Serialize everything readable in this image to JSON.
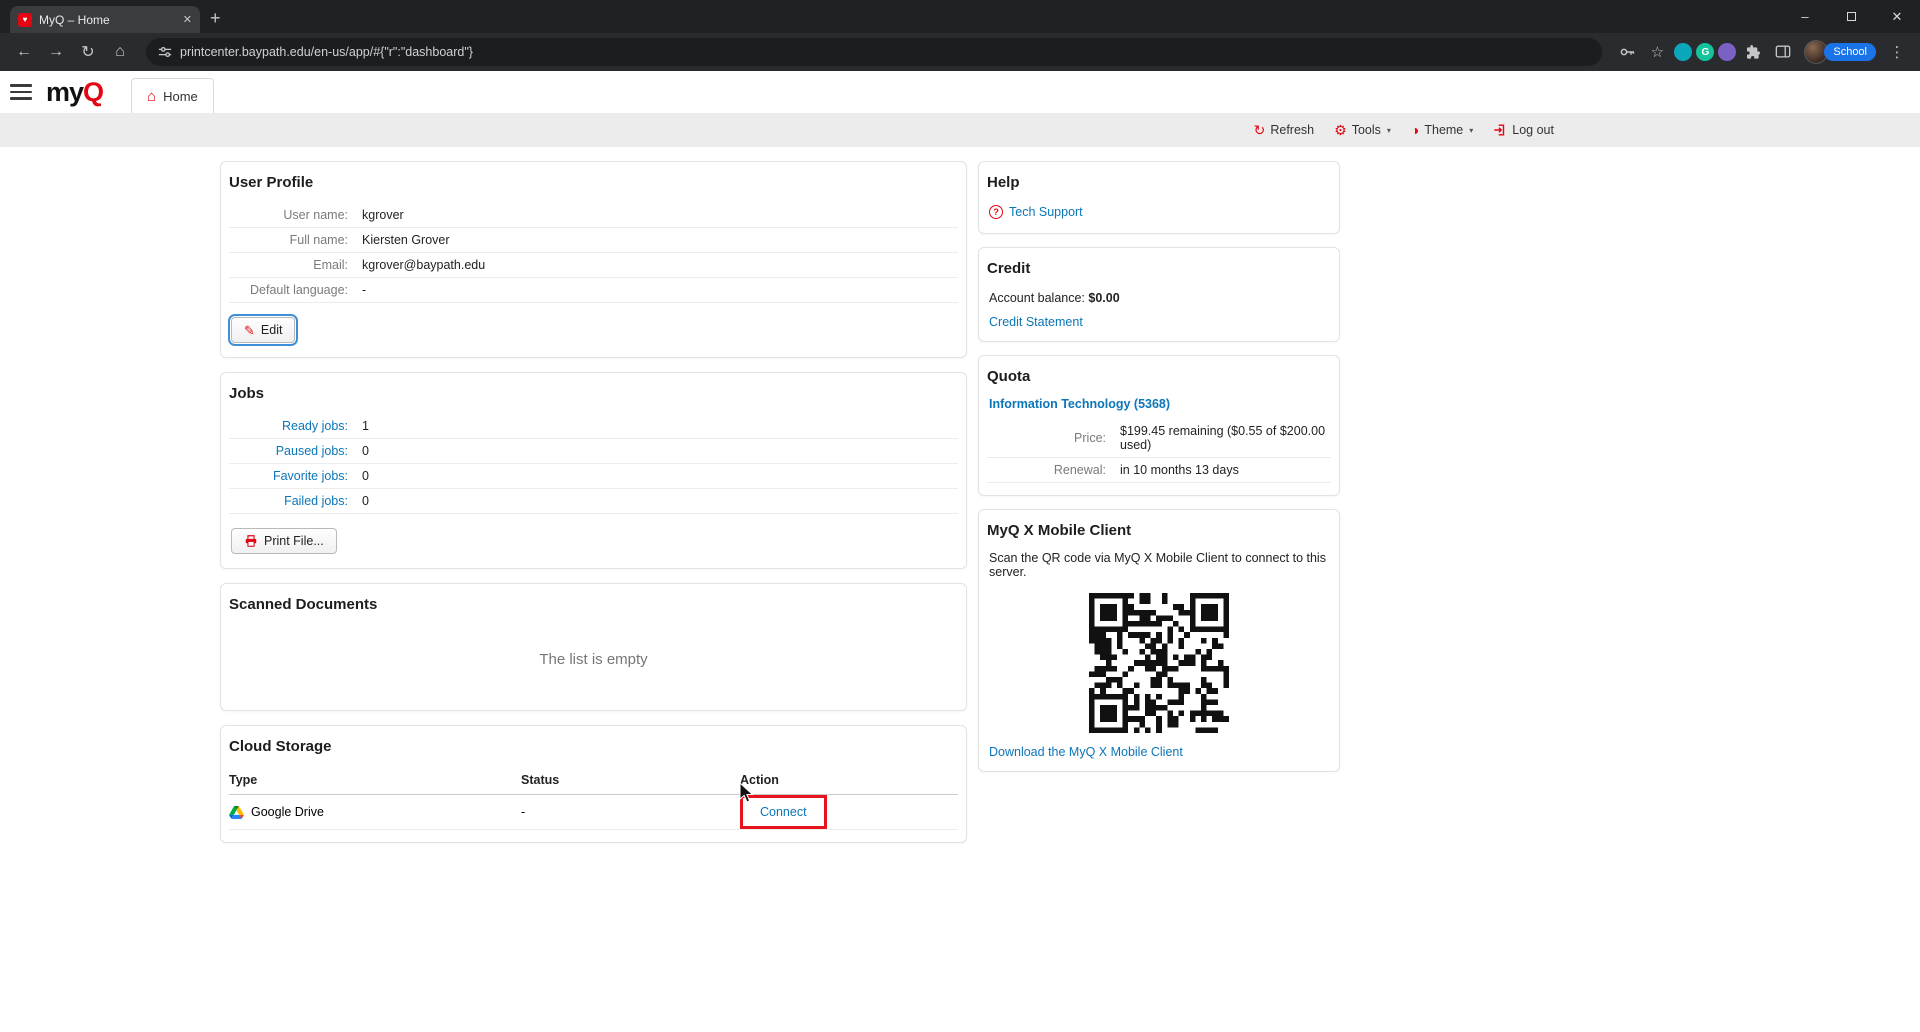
{
  "browser": {
    "tab_title": "MyQ – Home",
    "new_tab": "+",
    "url": "printcenter.baypath.edu/en-us/app/#{\"r\":\"dashboard\"}",
    "profile_label": "School",
    "extension_badge": "G"
  },
  "header": {
    "logo_my": "my",
    "logo_q": "Q",
    "home_tab_label": "Home"
  },
  "toolbar": {
    "refresh_label": "Refresh",
    "tools_label": "Tools",
    "theme_label": "Theme",
    "logout_label": "Log out"
  },
  "user_profile": {
    "title": "User Profile",
    "rows": [
      {
        "label": "User name:",
        "value": "kgrover"
      },
      {
        "label": "Full name:",
        "value": "Kiersten Grover"
      },
      {
        "label": "Email:",
        "value": "kgrover@baypath.edu"
      },
      {
        "label": "Default language:",
        "value": "-"
      }
    ],
    "edit_button_label": "Edit"
  },
  "jobs": {
    "title": "Jobs",
    "rows": [
      {
        "label": "Ready jobs:",
        "value": "1"
      },
      {
        "label": "Paused jobs:",
        "value": "0"
      },
      {
        "label": "Favorite jobs:",
        "value": "0"
      },
      {
        "label": "Failed jobs:",
        "value": "0"
      }
    ],
    "print_file_button_label": "Print File..."
  },
  "scanned_documents": {
    "title": "Scanned Documents",
    "empty_text": "The list is empty"
  },
  "cloud_storage": {
    "title": "Cloud Storage",
    "columns": [
      "Type",
      "Status",
      "Action"
    ],
    "rows": [
      {
        "type": "Google Drive",
        "status": "-",
        "action": "Connect"
      }
    ]
  },
  "help": {
    "title": "Help",
    "tech_support_label": "Tech Support"
  },
  "credit": {
    "title": "Credit",
    "balance_label": "Account balance:",
    "balance_value": "$0.00",
    "statement_label": "Credit Statement"
  },
  "quota": {
    "title": "Quota",
    "account_link": "Information Technology (5368)",
    "rows": [
      {
        "label": "Price:",
        "value": "$199.45 remaining ($0.55 of $200.00 used)"
      },
      {
        "label": "Renewal:",
        "value": "in 10 months 13 days"
      }
    ]
  },
  "mobile_client": {
    "title": "MyQ X Mobile Client",
    "instruction": "Scan the QR code via MyQ X Mobile Client to connect to this server.",
    "download_label": "Download the MyQ X Mobile Client"
  },
  "colors": {
    "brand_red": "#e30613",
    "link_blue": "#0b76b8",
    "highlight_red": "#e8131d",
    "profile_chip_blue": "#1a73e8"
  }
}
